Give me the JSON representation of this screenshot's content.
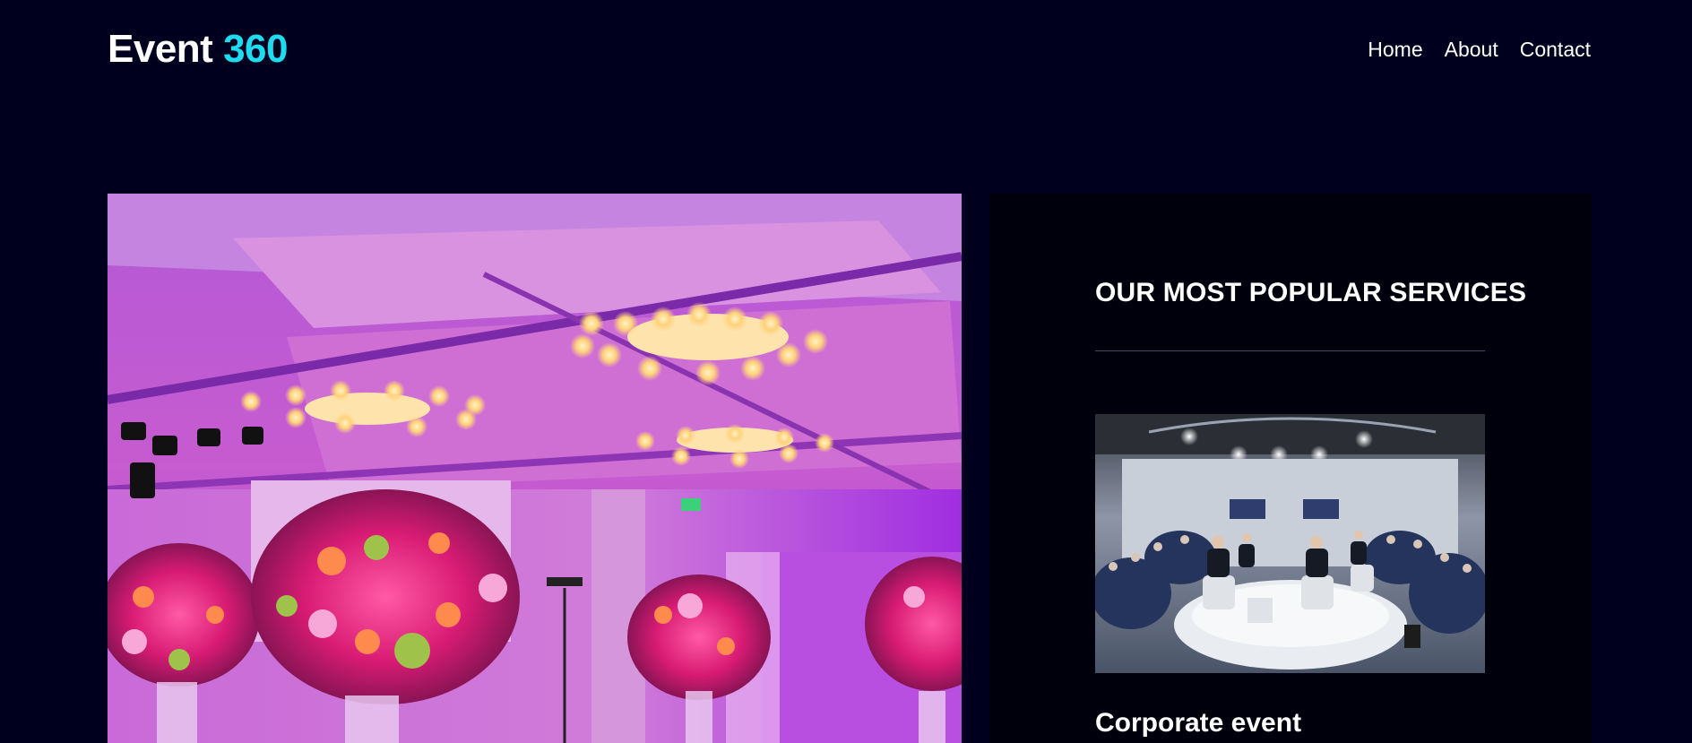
{
  "header": {
    "logo_main": "Event",
    "logo_accent": "360",
    "nav": {
      "home": "Home",
      "about": "About",
      "contact": "Contact"
    }
  },
  "colors": {
    "background": "#00001e",
    "accent": "#1ddcf0",
    "panel": "#00000d"
  },
  "services": {
    "heading": "OUR MOST POPULAR SERVICES",
    "items": [
      {
        "title": "Corporate event"
      }
    ]
  }
}
